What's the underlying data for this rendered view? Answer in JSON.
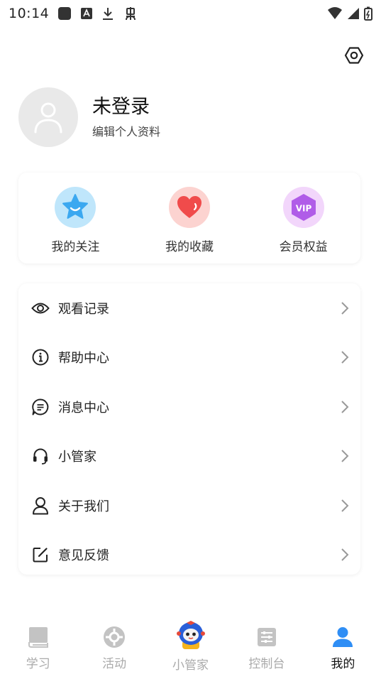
{
  "status_bar": {
    "time": "10:14"
  },
  "colors": {
    "accent": "#2f8ef5",
    "tab_inactive": "#aaaaaa",
    "tab_active": "#111111",
    "avatar_bg": "#e9e9e9"
  },
  "profile": {
    "name": "未登录",
    "edit_label": "编辑个人资料"
  },
  "quick_actions": [
    {
      "label": "我的关注",
      "icon": "star-icon"
    },
    {
      "label": "我的收藏",
      "icon": "heart-icon"
    },
    {
      "label": "会员权益",
      "icon": "vip-icon",
      "icon_text": "VIP"
    }
  ],
  "menu": [
    {
      "label": "观看记录",
      "icon": "eye-icon"
    },
    {
      "label": "帮助中心",
      "icon": "info-icon"
    },
    {
      "label": "消息中心",
      "icon": "message-icon"
    },
    {
      "label": "小管家",
      "icon": "headset-icon"
    },
    {
      "label": "关于我们",
      "icon": "user-icon"
    },
    {
      "label": "意见反馈",
      "icon": "edit-icon"
    }
  ],
  "tabs": [
    {
      "label": "学习",
      "icon": "book-icon",
      "active": false
    },
    {
      "label": "活动",
      "icon": "compass-icon",
      "active": false
    },
    {
      "label": "小管家",
      "icon": "robot-icon",
      "active": false
    },
    {
      "label": "控制台",
      "icon": "console-icon",
      "active": false
    },
    {
      "label": "我的",
      "icon": "person-icon",
      "active": true
    }
  ]
}
